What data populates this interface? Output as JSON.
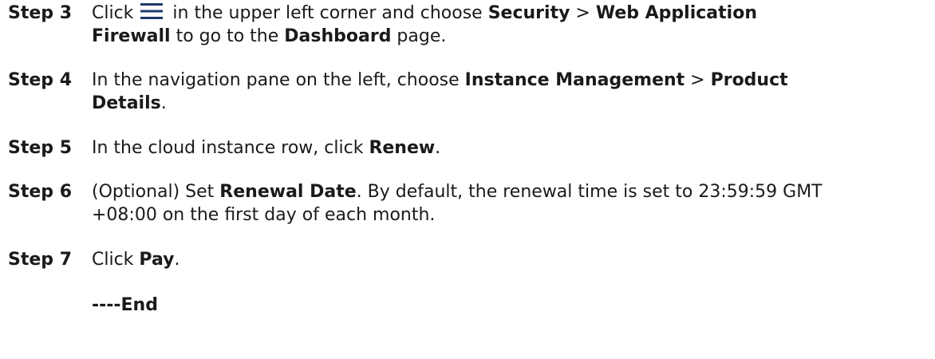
{
  "steps": [
    {
      "label": "Step 3",
      "parts": {
        "t1": "Click",
        "t2": " in the upper left corner and choose ",
        "b1": "Security",
        "t3": " > ",
        "b2": "Web Application",
        "b3": "Firewall",
        "t4": " to go to the ",
        "b4": "Dashboard",
        "t5": " page."
      },
      "icon": "hamburger-menu-icon"
    },
    {
      "label": "Step 4",
      "parts": {
        "t1": "In the navigation pane on the left, choose ",
        "b1": "Instance Management",
        "t2": " > ",
        "b2": "Product",
        "b3": "Details",
        "t3": "."
      }
    },
    {
      "label": "Step 5",
      "parts": {
        "t1": "In the cloud instance row, click ",
        "b1": "Renew",
        "t2": "."
      }
    },
    {
      "label": "Step 6",
      "parts": {
        "t1": "(Optional) Set ",
        "b1": "Renewal Date",
        "t2": ". By default, the renewal time is set to 23:59:59 GMT",
        "t3": "+08:00 on the first day of each month."
      }
    },
    {
      "label": "Step 7",
      "parts": {
        "t1": "Click ",
        "b1": "Pay",
        "t2": "."
      }
    }
  ],
  "end_marker": "----End",
  "colors": {
    "text": "#1a1a1a",
    "icon": "#1f3a6b"
  }
}
